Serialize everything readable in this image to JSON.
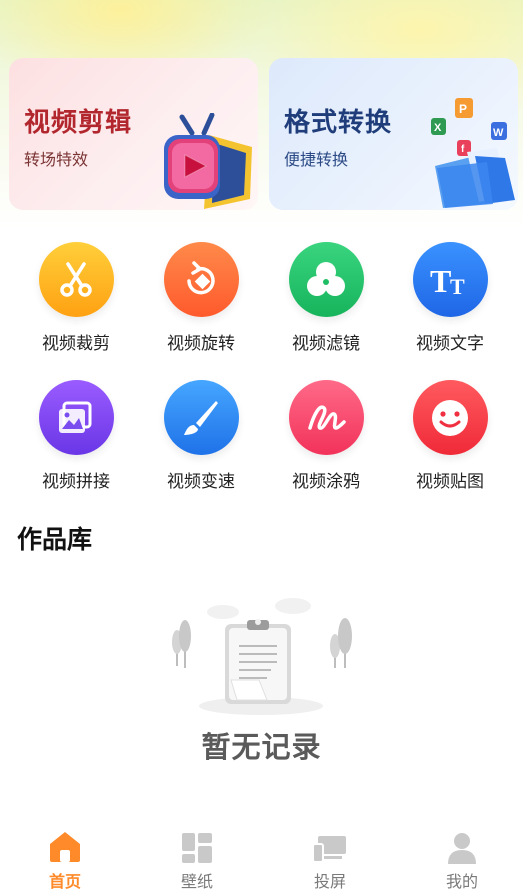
{
  "banners": {
    "left": {
      "title": "视频剪辑",
      "subtitle": "转场特效"
    },
    "right": {
      "title": "格式转换",
      "subtitle": "便捷转换"
    }
  },
  "tools": [
    {
      "label": "视频裁剪",
      "icon": "scissors-icon",
      "color": "#ffb21e"
    },
    {
      "label": "视频旋转",
      "icon": "rotate-icon",
      "color": "#ff6a3a"
    },
    {
      "label": "视频滤镜",
      "icon": "filter-icon",
      "color": "#22c46a"
    },
    {
      "label": "视频文字",
      "icon": "text-icon",
      "color": "#2b7df6"
    },
    {
      "label": "视频拼接",
      "icon": "collage-icon",
      "color": "#7a4cf0"
    },
    {
      "label": "视频变速",
      "icon": "brush-icon",
      "color": "#2f8ef5"
    },
    {
      "label": "视频涂鸦",
      "icon": "scribble-icon",
      "color": "#ff4a6e"
    },
    {
      "label": "视频贴图",
      "icon": "sticker-icon",
      "color": "#ff3d4a"
    }
  ],
  "library": {
    "title": "作品库",
    "empty_text": "暂无记录"
  },
  "tabbar": {
    "items": [
      {
        "label": "首页",
        "icon": "home-icon",
        "active": true
      },
      {
        "label": "壁纸",
        "icon": "wallpaper-icon",
        "active": false
      },
      {
        "label": "投屏",
        "icon": "cast-icon",
        "active": false
      },
      {
        "label": "我的",
        "icon": "profile-icon",
        "active": false
      }
    ],
    "active_color": "#ff8a2a",
    "inactive_color": "#c9c9c9"
  }
}
